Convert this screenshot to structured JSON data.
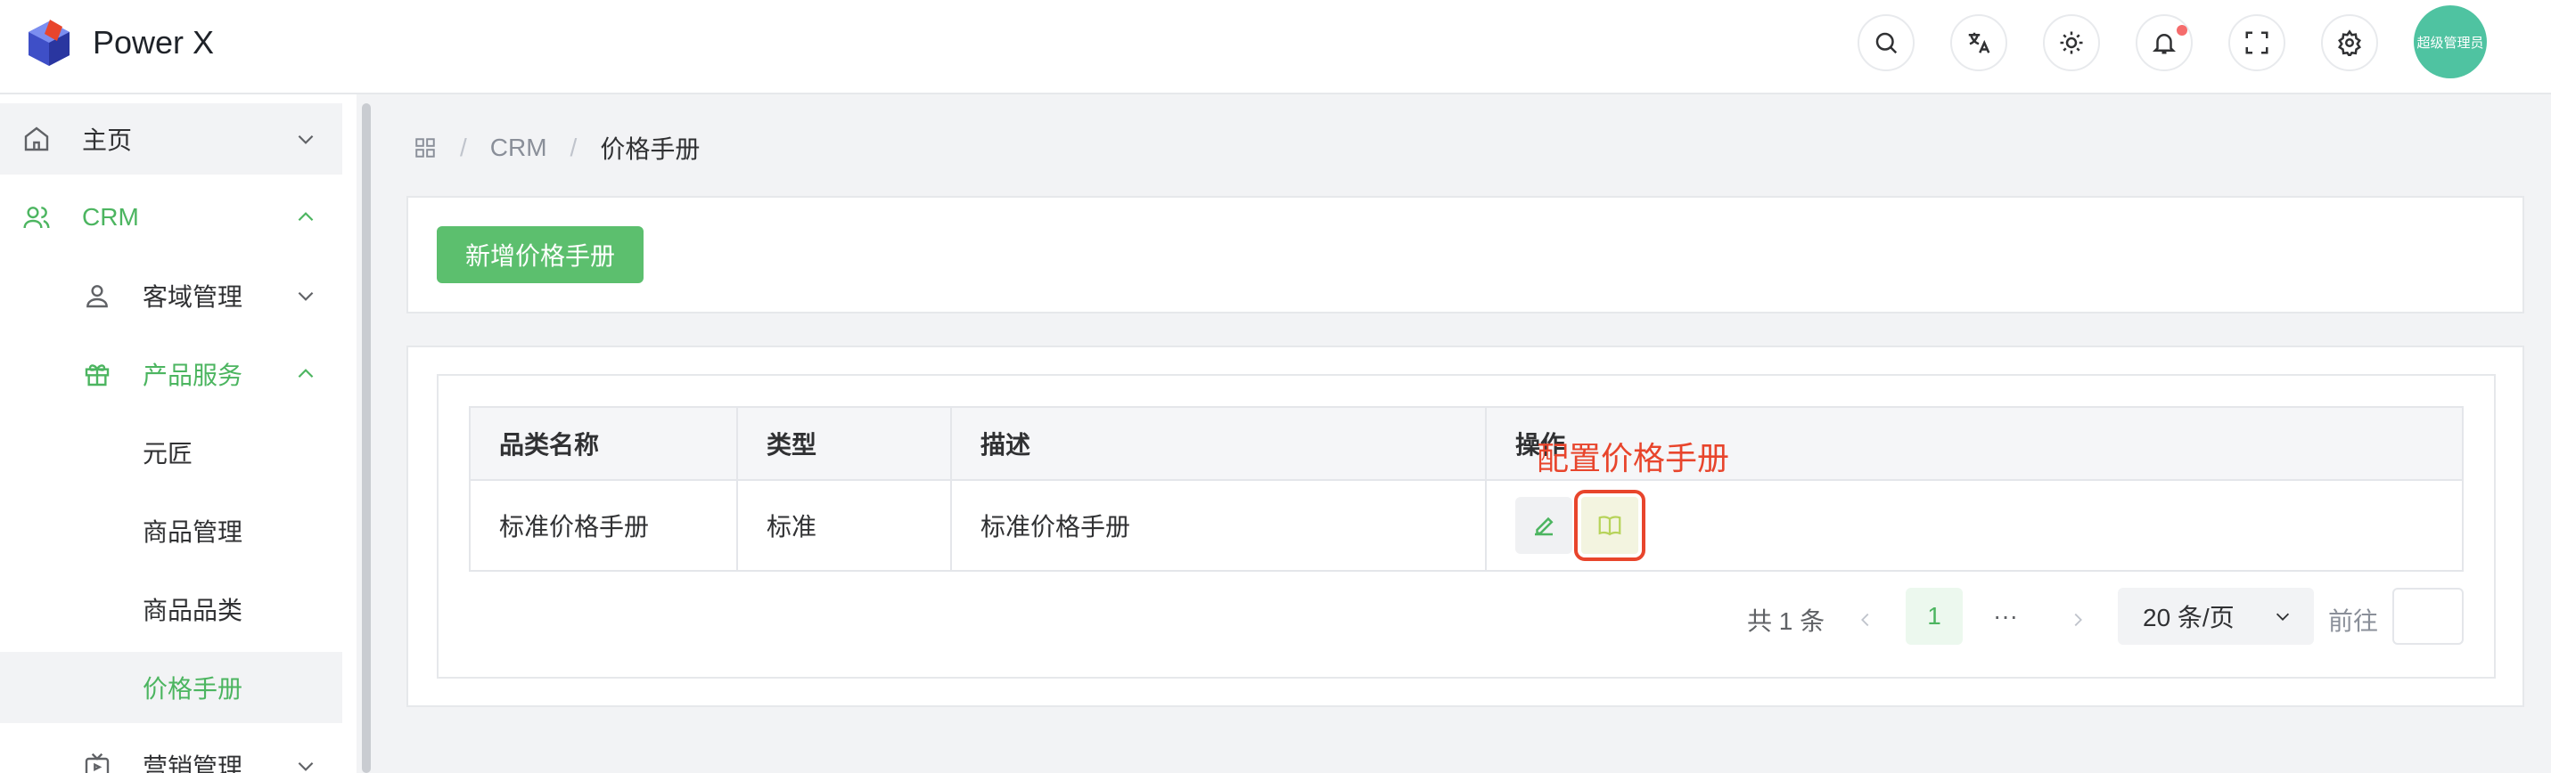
{
  "app": {
    "title": "Power X",
    "avatar_label": "超级管理员"
  },
  "header_icons": [
    "search-icon",
    "translate-icon",
    "theme-icon",
    "bell-icon",
    "fullscreen-icon",
    "settings-icon"
  ],
  "sidebar": {
    "items": [
      {
        "label": "主页",
        "icon": "home-icon"
      },
      {
        "label": "CRM",
        "icon": "users-icon"
      },
      {
        "label": "客域管理",
        "icon": "user-icon"
      },
      {
        "label": "产品服务",
        "icon": "gift-icon"
      },
      {
        "label": "元匠"
      },
      {
        "label": "商品管理"
      },
      {
        "label": "商品品类"
      },
      {
        "label": "价格手册"
      },
      {
        "label": "营销管理",
        "icon": "tv-icon"
      }
    ]
  },
  "breadcrumb": {
    "items": [
      "CRM",
      "价格手册"
    ],
    "separator": "/"
  },
  "toolbar": {
    "add_label": "新增价格手册"
  },
  "table": {
    "columns": [
      "品类名称",
      "类型",
      "描述",
      "操作"
    ],
    "rows": [
      {
        "name": "标准价格手册",
        "type": "标准",
        "desc": "标准价格手册"
      }
    ]
  },
  "annotation": "配置价格手册",
  "pagination": {
    "total": "共 1 条",
    "current": "1",
    "ellipsis": "···",
    "page_size": "20 条/页",
    "goto": "前往"
  },
  "colors": {
    "accent": "#4cb560",
    "annotation": "#e8452c",
    "avatar": "#4fc3a1"
  }
}
